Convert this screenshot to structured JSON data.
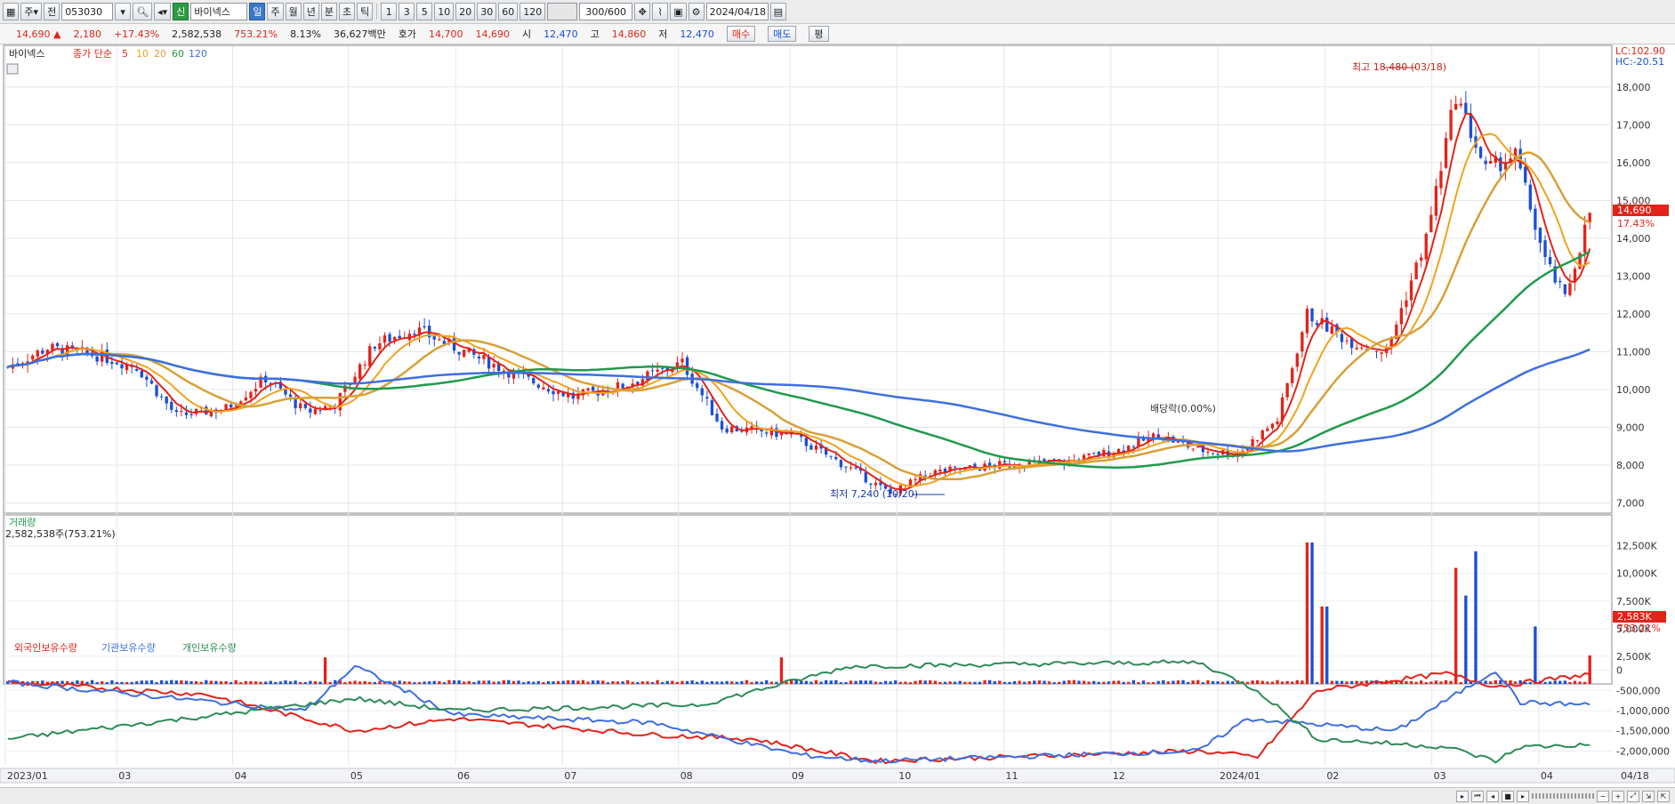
{
  "toolbar": {
    "market_mode": "주",
    "prev_label": "전",
    "stock_code": "053030",
    "badge": "신",
    "stock_name": "바이넥스",
    "periods": [
      "일",
      "주",
      "월",
      "년",
      "분",
      "초",
      "틱"
    ],
    "active_period": "일",
    "intervals": [
      "1",
      "3",
      "5",
      "10",
      "20",
      "30",
      "60",
      "120"
    ],
    "count_value": "300",
    "count_max": "/600",
    "date_value": "2024/04/18"
  },
  "quote": {
    "price": "14,690 ▲",
    "change": "2,180",
    "change_pct": "+17.43%",
    "volume": "2,582,538",
    "volume_pct": "753.21%",
    "turnover_pct": "8.13%",
    "amount": "36,627백만",
    "ask_label": "호가",
    "ask": "14,700",
    "bid": "14,690",
    "open_label": "시",
    "open": "12,470",
    "high_label": "고",
    "high": "14,860",
    "low_label": "저",
    "low": "12,470",
    "buy_label": "매수",
    "sell_label": "매도",
    "extra_label": "평"
  },
  "price_panel": {
    "stock_label": "바이넥스",
    "ma_label": "종가 단순",
    "ma_periods": [
      "5",
      "10",
      "20",
      "60",
      "120"
    ],
    "lc": "LC:102.90",
    "hc": "HC:-20.51",
    "current_price": "14,690",
    "current_pct": "17.43%",
    "high_note": "최고 18,480 (03/18)",
    "low_note": "최저 7,240 (10/20)",
    "dividend_note": "배당락(0.00%)"
  },
  "volume_panel": {
    "title": "거래량",
    "value": "2,582,538주(753.21%)",
    "current": "2,583K",
    "current_pct": "753.21%"
  },
  "holder_panel": {
    "legend": [
      "외국인보유수량",
      "기관보유수량",
      "개인보유수량"
    ]
  },
  "colors": {
    "up": "#e2231a",
    "down": "#1a4fd6",
    "ma5": "#e2231a",
    "ma10": "#f0a31e",
    "ma20": "#d8a038",
    "ma60": "#1f9a4c",
    "ma120": "#3e6fe0",
    "foreign": "#e2231a",
    "institution": "#3e6fe0",
    "individual": "#2e8b57"
  },
  "chart_data": [
    {
      "type": "candlestick",
      "name": "price",
      "y_axis_ticks": [
        "18,000",
        "17,000",
        "16,000",
        "15,000",
        "14,000",
        "13,000",
        "12,000",
        "11,000",
        "10,000",
        "9,000",
        "8,000",
        "7,000"
      ],
      "ylim": [
        6800,
        18700
      ],
      "x_axis_ticks": [
        "2023/01",
        "03",
        "04",
        "05",
        "06",
        "07",
        "08",
        "09",
        "10",
        "11",
        "12",
        "2024/01",
        "02",
        "03",
        "04",
        "04/18"
      ],
      "high": 18480,
      "low": 7240,
      "last_close": 14690,
      "series": [
        {
          "name": "5",
          "period": 5
        },
        {
          "name": "10",
          "period": 10
        },
        {
          "name": "20",
          "period": 20
        },
        {
          "name": "60",
          "period": 60
        },
        {
          "name": "120",
          "period": 120
        }
      ]
    },
    {
      "type": "bar",
      "name": "volume",
      "y_axis_ticks": [
        "12,500K",
        "10,000K",
        "7,500K",
        "5,000K",
        "2,500K"
      ],
      "ylim": [
        0,
        14000
      ]
    },
    {
      "type": "line",
      "name": "holdings",
      "y_axis_ticks": [
        "0",
        "-500,000",
        "-1,000,000",
        "-1,500,000",
        "-2,000,000"
      ],
      "ylim": [
        -2300000,
        300000
      ]
    }
  ]
}
